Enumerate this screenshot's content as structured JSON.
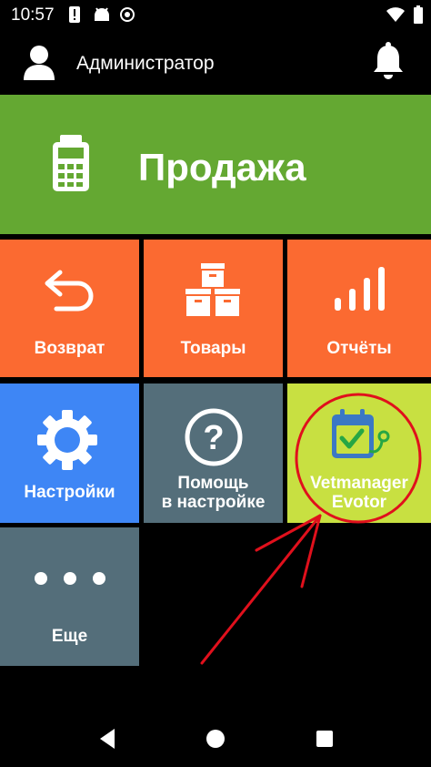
{
  "status_bar": {
    "time": "10:57",
    "icons": [
      "alert-icon",
      "android-icon",
      "record-icon",
      "wifi-icon",
      "battery-icon"
    ]
  },
  "header": {
    "user_name": "Администратор",
    "icons": [
      "user-avatar-icon",
      "notification-bell-icon"
    ]
  },
  "tiles": {
    "sale": {
      "label": "Продажа",
      "icon": "cash-register-icon",
      "color": "#64a832"
    },
    "return": {
      "label": "Возврат",
      "icon": "undo-arrow-icon",
      "color": "#fb6a31"
    },
    "goods": {
      "label": "Товары",
      "icon": "boxes-icon",
      "color": "#fb6a31"
    },
    "reports": {
      "label": "Отчёты",
      "icon": "signal-bars-icon",
      "color": "#fb6a31"
    },
    "settings": {
      "label": "Настройки",
      "icon": "gear-icon",
      "color": "#3e86f5"
    },
    "help": {
      "label_line1": "Помощь",
      "label_line2": "в настройке",
      "icon": "question-icon",
      "color": "#546e7a"
    },
    "vetmanager": {
      "label_line1": "Vetmanager",
      "label_line2": "Evotor",
      "icon": "calendar-stethoscope-icon",
      "color": "#c8e041"
    },
    "more": {
      "label": "Еще",
      "icon": "more-dots-icon",
      "color": "#546e7a"
    }
  },
  "annotation": {
    "color": "#e0101c"
  },
  "nav_bar": {
    "icons": [
      "back-icon",
      "home-icon",
      "recents-icon"
    ]
  }
}
